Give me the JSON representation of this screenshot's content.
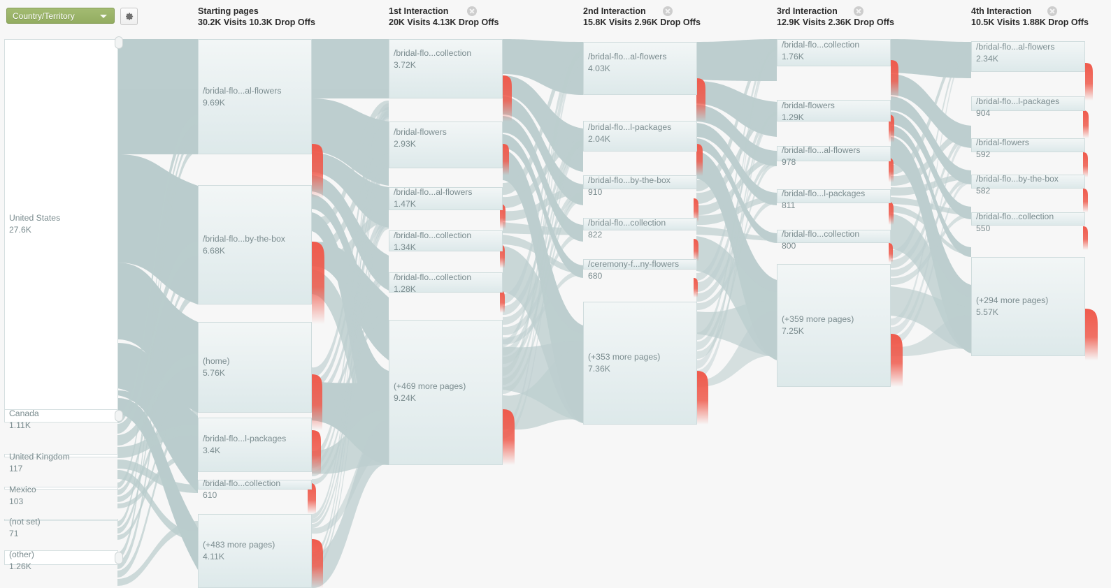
{
  "toolbar": {
    "dimension_label": "Country/Territory",
    "dimension_caret_icon": "chevron-down-icon",
    "settings_icon": "gear-icon"
  },
  "columns": [
    {
      "title": "Starting pages",
      "stats": "30.2K Visits 10.3K Drop Offs",
      "closable": false,
      "close_icon": "close-icon"
    },
    {
      "title": "1st Interaction",
      "stats": "20K Visits 4.13K Drop Offs",
      "closable": true,
      "close_icon": "close-icon"
    },
    {
      "title": "2nd Interaction",
      "stats": "15.8K Visits 2.96K Drop Offs",
      "closable": true,
      "close_icon": "close-icon"
    },
    {
      "title": "3rd Interaction",
      "stats": "12.9K Visits 2.36K Drop Offs",
      "closable": true,
      "close_icon": "close-icon"
    },
    {
      "title": "4th Interaction",
      "stats": "10.5K Visits 1.88K Drop Offs",
      "closable": true,
      "close_icon": "close-icon"
    }
  ],
  "dimension_nodes": [
    {
      "label": "United States",
      "value": "27.6K"
    },
    {
      "label": "Canada",
      "value": "1.11K"
    },
    {
      "label": "United Kingdom",
      "value": "117"
    },
    {
      "label": "Mexico",
      "value": "103"
    },
    {
      "label": "(not set)",
      "value": "71"
    },
    {
      "label": "(other)",
      "value": "1.26K"
    }
  ],
  "starting_pages": [
    {
      "label": "/bridal-flo...al-flowers",
      "value": "9.69K"
    },
    {
      "label": "/bridal-flo...by-the-box",
      "value": "6.68K"
    },
    {
      "label": "(home)",
      "value": "5.76K"
    },
    {
      "label": "/bridal-flo...l-packages",
      "value": "3.4K"
    },
    {
      "label": "/bridal-flo...collection",
      "value": "610"
    },
    {
      "label": "(+483 more pages)",
      "value": "4.11K"
    }
  ],
  "interaction_1": [
    {
      "label": "/bridal-flo...collection",
      "value": "3.72K"
    },
    {
      "label": "/bridal-flowers",
      "value": "2.93K"
    },
    {
      "label": "/bridal-flo...al-flowers",
      "value": "1.47K"
    },
    {
      "label": "/bridal-flo...collection",
      "value": "1.34K"
    },
    {
      "label": "/bridal-flo...collection",
      "value": "1.28K"
    },
    {
      "label": "(+469 more pages)",
      "value": "9.24K"
    }
  ],
  "interaction_2": [
    {
      "label": "/bridal-flo...al-flowers",
      "value": "4.03K"
    },
    {
      "label": "/bridal-flo...l-packages",
      "value": "2.04K"
    },
    {
      "label": "/bridal-flo...by-the-box",
      "value": "910"
    },
    {
      "label": "/bridal-flo...collection",
      "value": "822"
    },
    {
      "label": "/ceremony-f...ny-flowers",
      "value": "680"
    },
    {
      "label": "(+353 more pages)",
      "value": "7.36K"
    }
  ],
  "interaction_3": [
    {
      "label": "/bridal-flo...collection",
      "value": "1.76K"
    },
    {
      "label": "/bridal-flowers",
      "value": "1.29K"
    },
    {
      "label": "/bridal-flo...al-flowers",
      "value": "978"
    },
    {
      "label": "/bridal-flo...l-packages",
      "value": "811"
    },
    {
      "label": "/bridal-flo...collection",
      "value": "800"
    },
    {
      "label": "(+359 more pages)",
      "value": "7.25K"
    }
  ],
  "interaction_4": [
    {
      "label": "/bridal-flo...al-flowers",
      "value": "2.34K"
    },
    {
      "label": "/bridal-flo...l-packages",
      "value": "904"
    },
    {
      "label": "/bridal-flowers",
      "value": "592"
    },
    {
      "label": "/bridal-flo...by-the-box",
      "value": "582"
    },
    {
      "label": "/bridal-flo...collection",
      "value": "550"
    },
    {
      "label": "(+294 more pages)",
      "value": "5.57K"
    }
  ],
  "colors": {
    "node_fill": "#e7eff0",
    "node_border": "#cfdcdd",
    "flow_band": "#b7cacb",
    "dropoff": "#ef5a4c",
    "accent_green": "#9bb36a",
    "text": "#7b8c8f",
    "background": "#f7f7f7"
  },
  "chart_data": {
    "type": "sankey",
    "title": "Users Flow",
    "dimension": "Country/Territory",
    "stages": [
      {
        "name": "Starting pages",
        "visits": 30200,
        "drop_offs": 10300
      },
      {
        "name": "1st Interaction",
        "visits": 20000,
        "drop_offs": 4130
      },
      {
        "name": "2nd Interaction",
        "visits": 15800,
        "drop_offs": 2960
      },
      {
        "name": "3rd Interaction",
        "visits": 12900,
        "drop_offs": 2360
      },
      {
        "name": "4th Interaction",
        "visits": 10500,
        "drop_offs": 1880
      }
    ],
    "nodes": [
      {
        "stage": "dimension",
        "label": "United States",
        "value": 27600
      },
      {
        "stage": "dimension",
        "label": "Canada",
        "value": 1110
      },
      {
        "stage": "dimension",
        "label": "United Kingdom",
        "value": 117
      },
      {
        "stage": "dimension",
        "label": "Mexico",
        "value": 103
      },
      {
        "stage": "dimension",
        "label": "(not set)",
        "value": 71
      },
      {
        "stage": "dimension",
        "label": "(other)",
        "value": 1260
      },
      {
        "stage": "Starting pages",
        "label": "/bridal-flo...al-flowers",
        "value": 9690
      },
      {
        "stage": "Starting pages",
        "label": "/bridal-flo...by-the-box",
        "value": 6680
      },
      {
        "stage": "Starting pages",
        "label": "(home)",
        "value": 5760
      },
      {
        "stage": "Starting pages",
        "label": "/bridal-flo...l-packages",
        "value": 3400
      },
      {
        "stage": "Starting pages",
        "label": "/bridal-flo...collection",
        "value": 610
      },
      {
        "stage": "Starting pages",
        "label": "(+483 more pages)",
        "value": 4110
      },
      {
        "stage": "1st Interaction",
        "label": "/bridal-flo...collection",
        "value": 3720
      },
      {
        "stage": "1st Interaction",
        "label": "/bridal-flowers",
        "value": 2930
      },
      {
        "stage": "1st Interaction",
        "label": "/bridal-flo...al-flowers",
        "value": 1470
      },
      {
        "stage": "1st Interaction",
        "label": "/bridal-flo...collection",
        "value": 1340
      },
      {
        "stage": "1st Interaction",
        "label": "/bridal-flo...collection",
        "value": 1280
      },
      {
        "stage": "1st Interaction",
        "label": "(+469 more pages)",
        "value": 9240
      },
      {
        "stage": "2nd Interaction",
        "label": "/bridal-flo...al-flowers",
        "value": 4030
      },
      {
        "stage": "2nd Interaction",
        "label": "/bridal-flo...l-packages",
        "value": 2040
      },
      {
        "stage": "2nd Interaction",
        "label": "/bridal-flo...by-the-box",
        "value": 910
      },
      {
        "stage": "2nd Interaction",
        "label": "/bridal-flo...collection",
        "value": 822
      },
      {
        "stage": "2nd Interaction",
        "label": "/ceremony-f...ny-flowers",
        "value": 680
      },
      {
        "stage": "2nd Interaction",
        "label": "(+353 more pages)",
        "value": 7360
      },
      {
        "stage": "3rd Interaction",
        "label": "/bridal-flo...collection",
        "value": 1760
      },
      {
        "stage": "3rd Interaction",
        "label": "/bridal-flowers",
        "value": 1290
      },
      {
        "stage": "3rd Interaction",
        "label": "/bridal-flo...al-flowers",
        "value": 978
      },
      {
        "stage": "3rd Interaction",
        "label": "/bridal-flo...l-packages",
        "value": 811
      },
      {
        "stage": "3rd Interaction",
        "label": "/bridal-flo...collection",
        "value": 800
      },
      {
        "stage": "3rd Interaction",
        "label": "(+359 more pages)",
        "value": 7250
      },
      {
        "stage": "4th Interaction",
        "label": "/bridal-flo...al-flowers",
        "value": 2340
      },
      {
        "stage": "4th Interaction",
        "label": "/bridal-flo...l-packages",
        "value": 904
      },
      {
        "stage": "4th Interaction",
        "label": "/bridal-flowers",
        "value": 592
      },
      {
        "stage": "4th Interaction",
        "label": "/bridal-flo...by-the-box",
        "value": 582
      },
      {
        "stage": "4th Interaction",
        "label": "/bridal-flo...collection",
        "value": 550
      },
      {
        "stage": "4th Interaction",
        "label": "(+294 more pages)",
        "value": 5570
      }
    ]
  }
}
